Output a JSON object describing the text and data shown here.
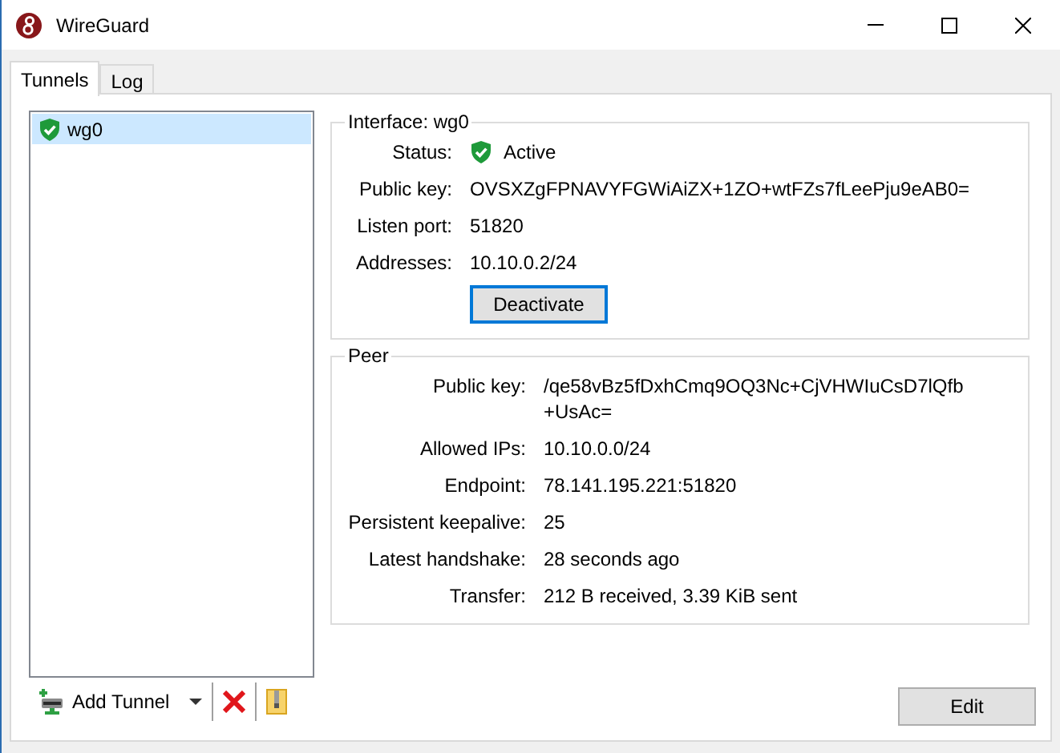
{
  "window": {
    "title": "WireGuard"
  },
  "tabs": [
    {
      "label": "Tunnels",
      "selected": true
    },
    {
      "label": "Log",
      "selected": false
    }
  ],
  "tunnels": [
    {
      "name": "wg0",
      "selected": true,
      "active": true
    }
  ],
  "toolbar": {
    "add_label": "Add Tunnel"
  },
  "interface": {
    "title": "Interface: wg0",
    "status": {
      "label": "Status:",
      "value": "Active",
      "active": true
    },
    "fields": [
      {
        "label": "Public key:",
        "value": "OVSXZgFPNAVYFGWiAiZX+1ZO+wtFZs7fLeePju9eAB0="
      },
      {
        "label": "Listen port:",
        "value": "51820"
      },
      {
        "label": "Addresses:",
        "value": "10.10.0.2/24"
      }
    ],
    "button": "Deactivate"
  },
  "peer": {
    "title": "Peer",
    "fields": [
      {
        "label": "Public key:",
        "value": "/qe58vBz5fDxhCmq9OQ3Nc+CjVHWIuCsD7lQfb+UsAc="
      },
      {
        "label": "Allowed IPs:",
        "value": "10.10.0.0/24"
      },
      {
        "label": "Endpoint:",
        "value": "78.141.195.221:51820"
      },
      {
        "label": "Persistent keepalive:",
        "value": "25"
      },
      {
        "label": "Latest handshake:",
        "value": "28 seconds ago"
      },
      {
        "label": "Transfer:",
        "value": "212 B received, 3.39 KiB sent"
      }
    ]
  },
  "edit_button": "Edit"
}
